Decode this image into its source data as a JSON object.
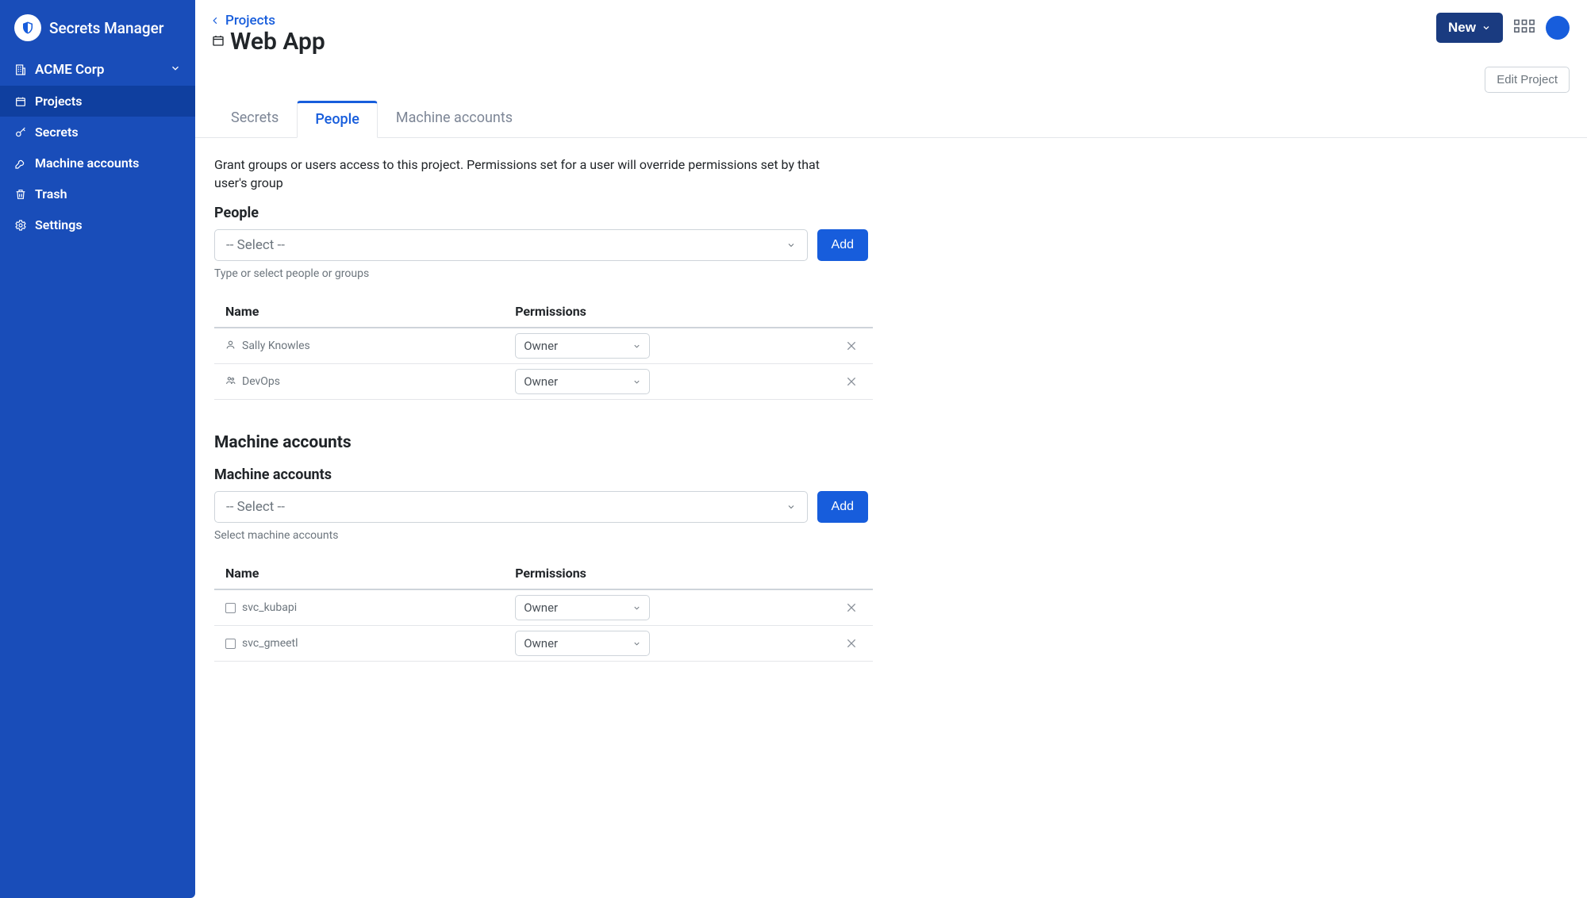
{
  "brand": {
    "name": "Secrets Manager"
  },
  "org": {
    "name": "ACME Corp"
  },
  "sidebar": {
    "items": [
      {
        "label": "Projects",
        "icon": "project",
        "active": true
      },
      {
        "label": "Secrets",
        "icon": "key",
        "active": false
      },
      {
        "label": "Machine accounts",
        "icon": "wrench",
        "active": false
      },
      {
        "label": "Trash",
        "icon": "trash",
        "active": false
      },
      {
        "label": "Settings",
        "icon": "gear",
        "active": false
      }
    ]
  },
  "header": {
    "breadcrumb": "Projects",
    "title": "Web App",
    "new_button": "New",
    "edit_button": "Edit Project"
  },
  "tabs": [
    {
      "label": "Secrets",
      "active": false
    },
    {
      "label": "People",
      "active": true
    },
    {
      "label": "Machine accounts",
      "active": false
    }
  ],
  "people": {
    "description": "Grant groups or users access to this project. Permissions set for a user will override permissions set by that user's group",
    "section_label": "People",
    "select_placeholder": "-- Select --",
    "add_label": "Add",
    "hint": "Type or select people or groups",
    "columns": {
      "name": "Name",
      "permissions": "Permissions"
    },
    "rows": [
      {
        "icon": "person",
        "name": "Sally Knowles",
        "permission": "Owner"
      },
      {
        "icon": "group",
        "name": "DevOps",
        "permission": "Owner"
      }
    ]
  },
  "machines": {
    "heading": "Machine accounts",
    "section_label": "Machine accounts",
    "select_placeholder": "-- Select --",
    "add_label": "Add",
    "hint": "Select machine accounts",
    "columns": {
      "name": "Name",
      "permissions": "Permissions"
    },
    "rows": [
      {
        "name": "svc_kubapi",
        "permission": "Owner"
      },
      {
        "name": "svc_gmeetl",
        "permission": "Owner"
      }
    ]
  }
}
